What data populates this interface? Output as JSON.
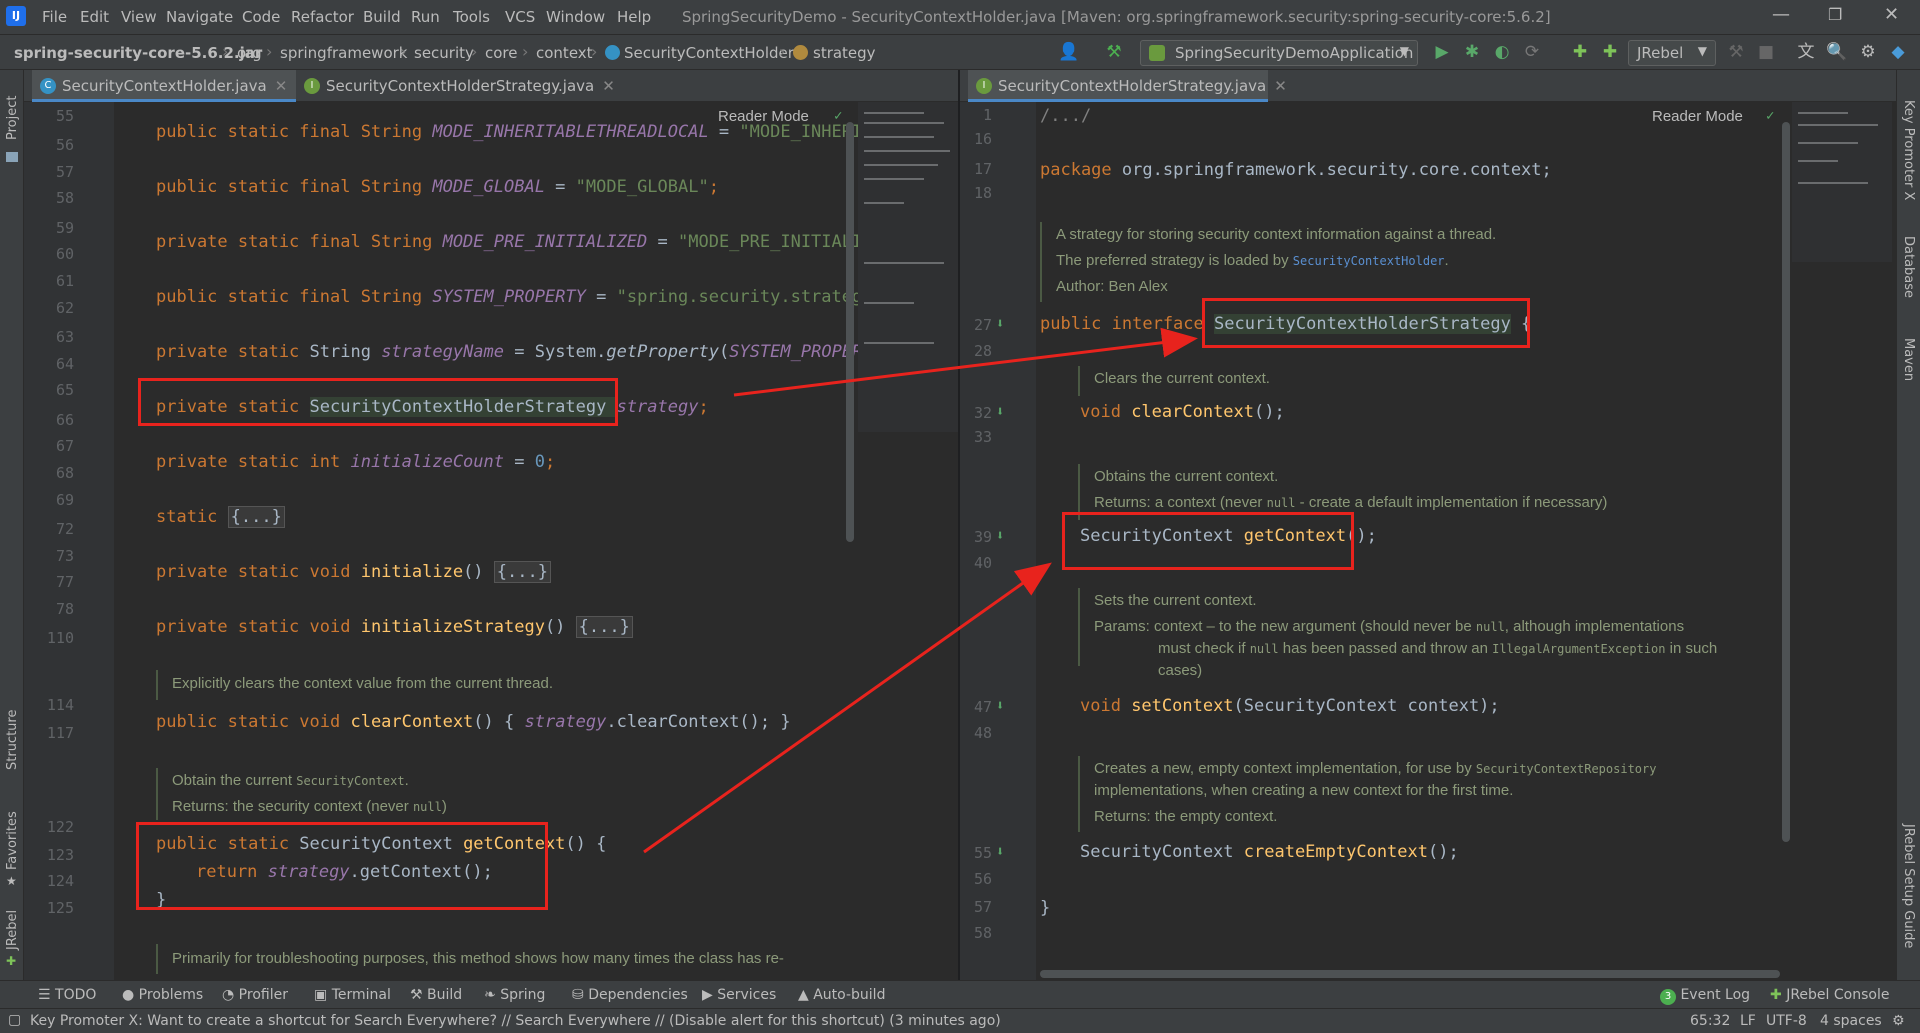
{
  "menu": {
    "items": [
      "File",
      "Edit",
      "View",
      "Navigate",
      "Code",
      "Refactor",
      "Build",
      "Run",
      "Tools",
      "VCS",
      "Window",
      "Help"
    ],
    "window_title": "SpringSecurityDemo - SecurityContextHolder.java [Maven: org.springframework.security:spring-security-core:5.6.2]"
  },
  "breadcrumb": {
    "jar": "spring-security-core-5.6.2.jar",
    "parts": [
      "org",
      "springframework",
      "security",
      "core",
      "context"
    ],
    "class": "SecurityContextHolder",
    "field": "strategy"
  },
  "toolbar": {
    "run_config": "SpringSecurityDemoApplication",
    "jrebel": "JRebel"
  },
  "left_strip": {
    "project": "Project",
    "structure": "Structure",
    "favorites": "Favorites",
    "jrebel": "JRebel"
  },
  "right_strip": {
    "key_promoter": "Key Promoter X",
    "database": "Database",
    "maven": "Maven",
    "jrebel_guide": "JRebel Setup Guide"
  },
  "left_tabs": [
    {
      "label": "SecurityContextHolder.java",
      "active": true
    },
    {
      "label": "SecurityContextHolderStrategy.java",
      "active": false
    }
  ],
  "right_tabs": [
    {
      "label": "SecurityContextHolderStrategy.java",
      "active": true
    }
  ],
  "reader_mode": "Reader Mode",
  "left_editor": {
    "line_numbers": [
      "54",
      "55",
      "56",
      "57",
      "58",
      "59",
      "60",
      "61",
      "62",
      "63",
      "64",
      "65",
      "66",
      "67",
      "68",
      "69",
      "72",
      "73",
      "77",
      "78",
      "110",
      "114",
      "117",
      "122",
      "123",
      "124",
      "125"
    ],
    "lines": {
      "l55": {
        "kw": "public static final String ",
        "name": "MODE_INHERITABLETHREADLOCAL",
        "rest": " = ",
        "str": "\"MODE_INHERI"
      },
      "l57": {
        "kw": "public static final String ",
        "name": "MODE_GLOBAL",
        "rest": " = ",
        "str": "\"MODE_GLOBAL\"",
        "end": ";"
      },
      "l59": {
        "kw": "private static final String ",
        "name": "MODE_PRE_INITIALIZED",
        "rest": " = ",
        "str": "\"MODE_PRE_INITIALIZ"
      },
      "l61": {
        "kw": "public static final String ",
        "name": "SYSTEM_PROPERTY",
        "rest": " = ",
        "str": "\"spring.security.strategy"
      },
      "l63": {
        "kw": "private static ",
        "type": "String ",
        "name": "strategyName",
        "rest": " = System.",
        "fn": "getProperty",
        "rest2": "(",
        "name2": "SYSTEM_PROPERT"
      },
      "l65": {
        "kw": "private static ",
        "type": "SecurityContextHolderStrategy ",
        "name": "strategy",
        "end": ";"
      },
      "l67": {
        "kw": "private static int ",
        "name": "initializeCount",
        "rest": " = ",
        "num": "0",
        "end": ";"
      },
      "l69": {
        "kw": "static ",
        "fold": "{...}"
      },
      "l73": {
        "kw": "private static void ",
        "fn": "initialize",
        "rest": "() ",
        "fold": "{...}"
      },
      "l78": {
        "kw": "private static void ",
        "fn": "initializeStrategy",
        "rest": "() ",
        "fold": "{...}"
      },
      "doc1": "Explicitly clears the context value from the current thread.",
      "l114": {
        "kw": "public static void ",
        "fn": "clearContext",
        "rest": "() { ",
        "name": "strategy",
        "rest2": ".clearContext(); }"
      },
      "doc2a": "Obtain the current ",
      "doc2a_code": "SecurityContext",
      "doc2a_end": ".",
      "doc2b": "Returns:  the security context (never ",
      "doc2b_code": "null",
      "doc2b_end": ")",
      "l122": {
        "kw": "public static ",
        "type": "SecurityContext ",
        "fn": "getContext",
        "rest": "() {"
      },
      "l123": {
        "kw": "return ",
        "name": "strategy",
        "rest": ".getContext();"
      },
      "l124": "}",
      "doc3": "Primarily for troubleshooting purposes, this method shows how many times the class has re-"
    }
  },
  "right_editor": {
    "line_numbers": [
      "1",
      "16",
      "17",
      "18",
      "27",
      "28",
      "32",
      "33",
      "39",
      "40",
      "47",
      "48",
      "55",
      "56",
      "57",
      "58"
    ],
    "l1": "/.../",
    "l17": {
      "kw": "package ",
      "rest": "org.springframework.security.core.context;"
    },
    "doc_a1": "A strategy for storing security context information against a thread.",
    "doc_a2": "The preferred strategy is loaded by ",
    "doc_a2_code": "SecurityContextHolder",
    "doc_a2_end": ".",
    "doc_a3": "Author: Ben Alex",
    "l27": {
      "kw": "public interface ",
      "name": "SecurityContextHolderStrategy",
      "end": " {"
    },
    "doc_b": "Clears the current context.",
    "l32": {
      "kw": "void ",
      "fn": "clearContext",
      "end": "();"
    },
    "doc_c1": "Obtains the current context.",
    "doc_c2": "Returns: a context (never ",
    "doc_c2_code": "null",
    "doc_c2_end": " - create a default implementation if necessary)",
    "l39": {
      "type": "SecurityContext ",
      "fn": "getContext",
      "end": "();"
    },
    "doc_d1": "Sets the current context.",
    "doc_d2a": "Params:  context – to the new argument (should never be ",
    "doc_d2a_code": "null",
    "doc_d2a_end": ", although implementations",
    "doc_d2b": "must check if ",
    "doc_d2b_code": "null",
    "doc_d2b_mid": " has been passed and throw an ",
    "doc_d2b_code2": "IllegalArgumentException",
    "doc_d2b_end": " in such",
    "doc_d2c": "cases)",
    "l47": {
      "kw": "void ",
      "fn": "setContext",
      "rest": "(SecurityContext context);"
    },
    "doc_e1": "Creates a new, empty context implementation, for use by ",
    "doc_e1_code": "SecurityContextRepository",
    "doc_e2": "implementations, when creating a new context for the first time.",
    "doc_e3": "Returns:  the empty context.",
    "l55": {
      "type": "SecurityContext ",
      "fn": "createEmptyContext",
      "end": "();"
    },
    "l57": "}"
  },
  "bottom_tools": [
    "TODO",
    "Problems",
    "Profiler",
    "Terminal",
    "Build",
    "Spring",
    "Dependencies",
    "Services",
    "Auto-build"
  ],
  "bottom_right_tools": {
    "event_log_count": "3",
    "event_log": "Event Log",
    "jrebel_console": "JRebel Console"
  },
  "status": {
    "message": "Key Promoter X: Want to create a shortcut for Search Everywhere? // Search Everywhere // (Disable alert for this shortcut) (3 minutes ago)",
    "position": "65:32",
    "line_sep": "LF",
    "encoding": "UTF-8",
    "indent": "4 spaces"
  },
  "colors": {
    "highlight_box": "#e8231d",
    "keyword": "#cc7832",
    "string": "#6a8759",
    "function": "#ffc66d",
    "field": "#9876aa"
  }
}
